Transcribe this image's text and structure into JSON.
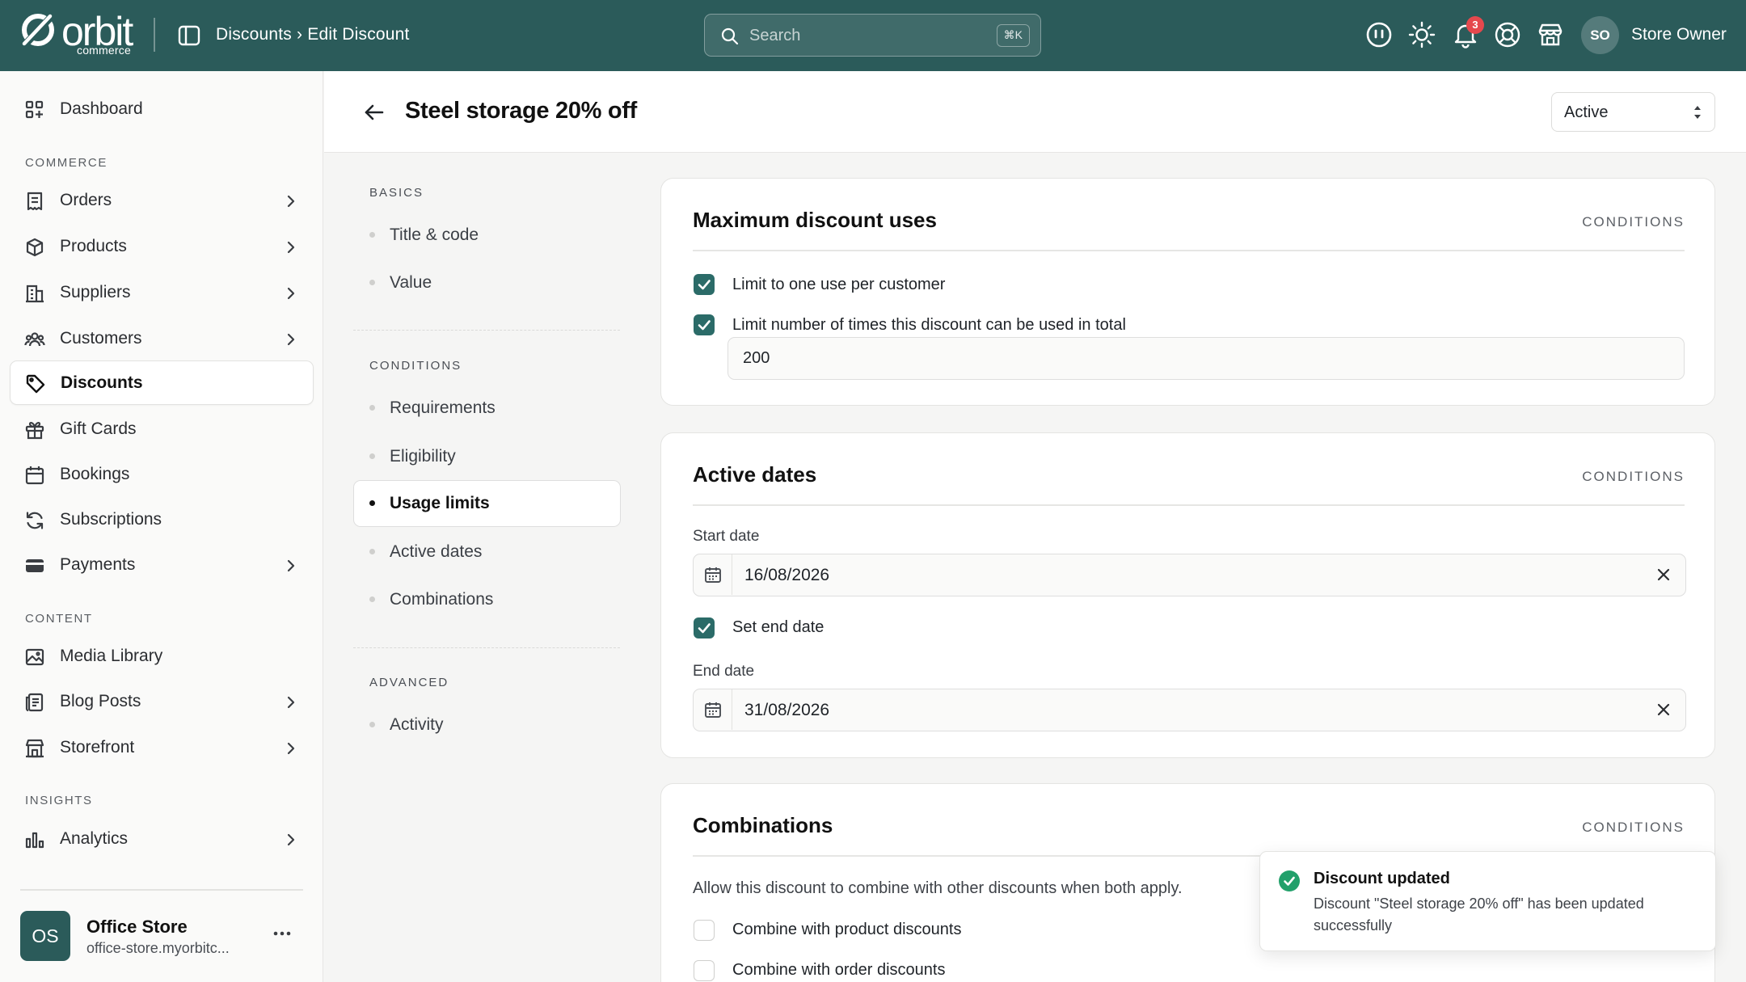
{
  "app": {
    "logo_text": "orbit",
    "logo_sub": "commerce",
    "breadcrumb": "Discounts › Edit Discount",
    "search_placeholder": "Search",
    "search_shortcut": "⌘K",
    "notification_count": "3",
    "user_initials": "SO",
    "user_name": "Store Owner",
    "accent_color": "#2b5b5a"
  },
  "sidebar": {
    "dashboard": "Dashboard",
    "section_commerce": "COMMERCE",
    "orders": "Orders",
    "products": "Products",
    "suppliers": "Suppliers",
    "customers": "Customers",
    "discounts": "Discounts",
    "gift_cards": "Gift Cards",
    "bookings": "Bookings",
    "subscriptions": "Subscriptions",
    "payments": "Payments",
    "section_content": "CONTENT",
    "media_library": "Media Library",
    "blog_posts": "Blog Posts",
    "storefront": "Storefront",
    "section_insights": "INSIGHTS",
    "analytics": "Analytics",
    "store_initials": "OS",
    "store_name": "Office Store",
    "store_url": "office-store.myorbitc..."
  },
  "page": {
    "title": "Steel storage 20% off",
    "status": "Active"
  },
  "section_nav": {
    "basics_label": "BASICS",
    "title_code": "Title & code",
    "value": "Value",
    "conditions_label": "CONDITIONS",
    "requirements": "Requirements",
    "eligibility": "Eligibility",
    "usage_limits": "Usage limits",
    "active_dates": "Active dates",
    "combinations": "Combinations",
    "advanced_label": "ADVANCED",
    "activity": "Activity"
  },
  "usage_card": {
    "title": "Maximum discount uses",
    "tag": "CONDITIONS",
    "one_per_customer_label": "Limit to one use per customer",
    "one_per_customer_checked": true,
    "limit_total_label": "Limit number of times this discount can be used in total",
    "limit_total_checked": true,
    "limit_total_value": "200"
  },
  "dates_card": {
    "title": "Active dates",
    "tag": "CONDITIONS",
    "start_label": "Start date",
    "start_value": "16/08/2026",
    "set_end_label": "Set end date",
    "set_end_checked": true,
    "end_label": "End date",
    "end_value": "31/08/2026"
  },
  "combinations_card": {
    "title": "Combinations",
    "tag": "CONDITIONS",
    "help": "Allow this discount to combine with other discounts when both apply.",
    "product_label": "Combine with product discounts",
    "product_checked": false,
    "order_label": "Combine with order discounts",
    "order_checked": false
  },
  "toast": {
    "title": "Discount updated",
    "message": "Discount \"Steel storage 20% off\" has been updated successfully"
  }
}
